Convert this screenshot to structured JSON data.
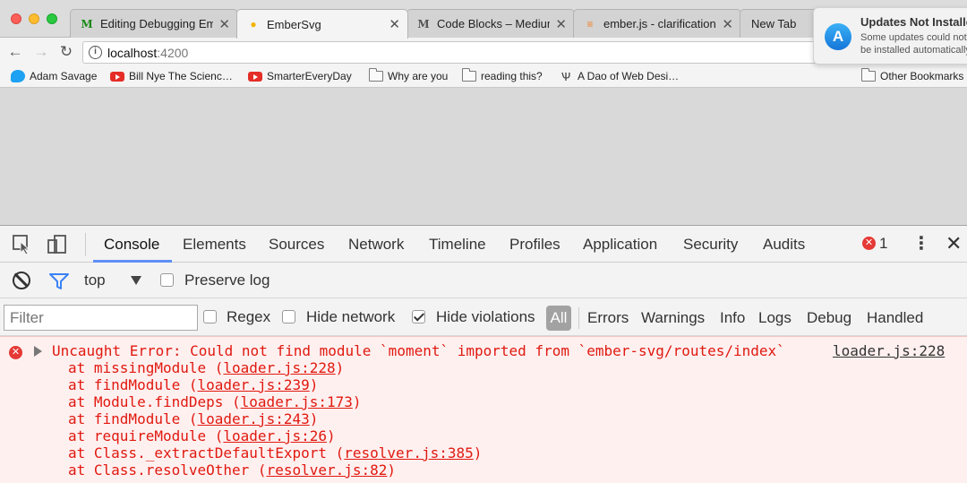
{
  "tabs": [
    {
      "label": "Editing Debugging Emb",
      "favicon": "medium-icon",
      "active": false
    },
    {
      "label": "EmberSvg",
      "favicon": "ember-icon",
      "active": true
    },
    {
      "label": "Code Blocks – Medium",
      "favicon": "medium-icon",
      "active": false
    },
    {
      "label": "ember.js - clarification",
      "favicon": "stackoverflow-icon",
      "active": false
    },
    {
      "label": "New Tab",
      "favicon": "",
      "active": false
    }
  ],
  "notification": {
    "title": "Updates Not Installed",
    "body": "Some updates could not be installed automatically."
  },
  "address": {
    "host": "localhost",
    "port": ":4200"
  },
  "bookmarks": [
    {
      "label": "Adam Savage",
      "icon": "twitter-icon"
    },
    {
      "label": "Bill Nye The Scienc…",
      "icon": "youtube-icon"
    },
    {
      "label": "SmarterEveryDay",
      "icon": "youtube-icon"
    },
    {
      "label": "Why are you",
      "icon": "folder-icon"
    },
    {
      "label": "reading this?",
      "icon": "folder-icon"
    },
    {
      "label": "A Dao of Web Desi…",
      "icon": "dao-icon"
    },
    {
      "label": "Other Bookmarks",
      "icon": "folder-icon"
    }
  ],
  "devtools": {
    "tabs": [
      "Console",
      "Elements",
      "Sources",
      "Network",
      "Timeline",
      "Profiles",
      "Application",
      "Security",
      "Audits"
    ],
    "error_count": "1",
    "context": "top",
    "preserve_log": "Preserve log",
    "filter_placeholder": "Filter",
    "regex": "Regex",
    "hide_network": "Hide network",
    "hide_violations": "Hide violations",
    "all": "All",
    "levels": [
      "Errors",
      "Warnings",
      "Info",
      "Logs",
      "Debug",
      "Handled"
    ]
  },
  "console": {
    "error_message": "Uncaught Error: Could not find module `moment` imported from `ember-svg/routes/index`",
    "source": "loader.js:228",
    "stack": [
      {
        "prefix": "at missingModule (",
        "link": "loader.js:228",
        "suffix": ")"
      },
      {
        "prefix": "at findModule (",
        "link": "loader.js:239",
        "suffix": ")"
      },
      {
        "prefix": "at Module.findDeps (",
        "link": "loader.js:173",
        "suffix": ")"
      },
      {
        "prefix": "at findModule (",
        "link": "loader.js:243",
        "suffix": ")"
      },
      {
        "prefix": "at requireModule (",
        "link": "loader.js:26",
        "suffix": ")"
      },
      {
        "prefix": "at Class._extractDefaultExport (",
        "link": "resolver.js:385",
        "suffix": ")"
      },
      {
        "prefix": "at Class.resolveOther (",
        "link": "resolver.js:82",
        "suffix": ")"
      }
    ]
  },
  "colors": {
    "error_red": "#e0190f",
    "error_bg": "#fff0f0",
    "accent_blue": "#5e8ff5"
  }
}
